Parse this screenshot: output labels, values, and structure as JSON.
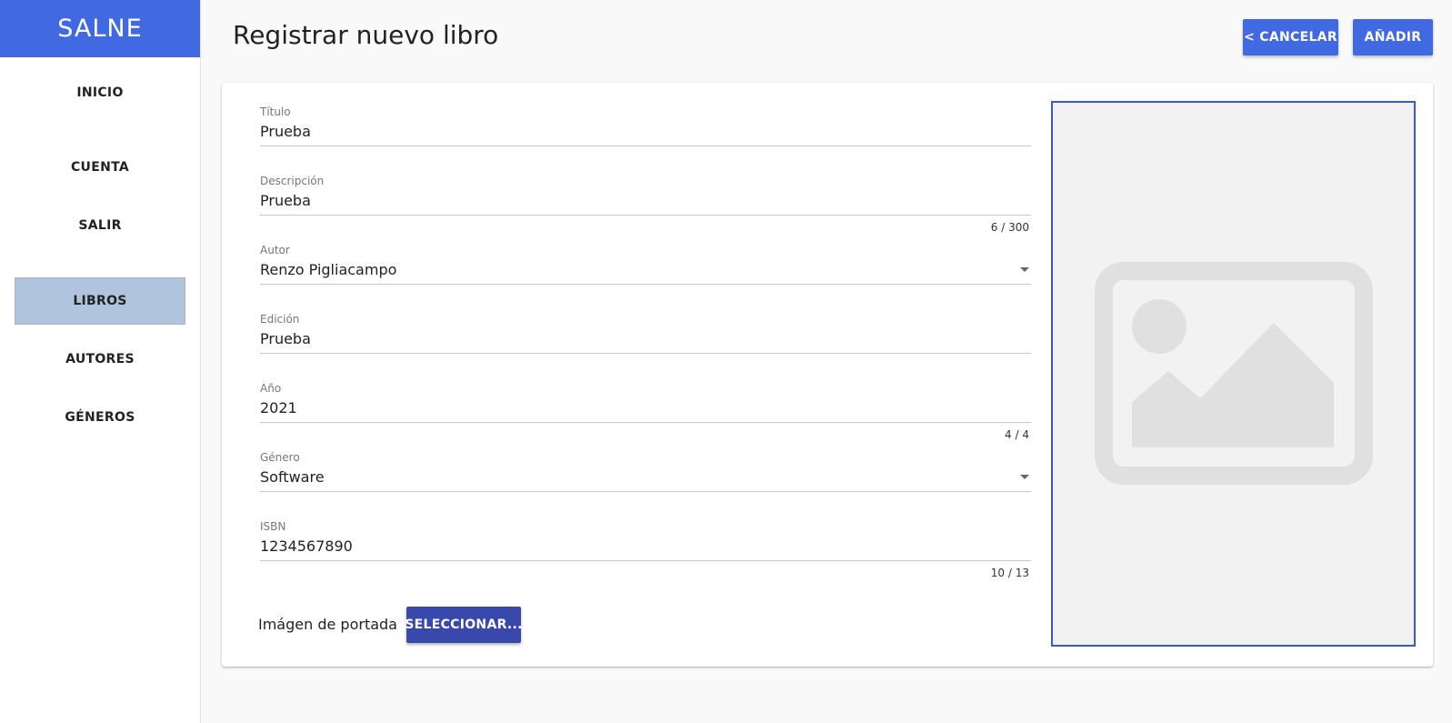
{
  "brand": "SALNE",
  "sidebar": {
    "items": [
      {
        "label": "INICIO"
      },
      {
        "label": "CUENTA"
      },
      {
        "label": "SALIR"
      },
      {
        "label": "LIBROS"
      },
      {
        "label": "AUTORES"
      },
      {
        "label": "GÉNEROS"
      }
    ],
    "active": "LIBROS"
  },
  "header": {
    "title": "Registrar nuevo libro",
    "cancel_label": "< CANCELAR",
    "add_label": "AÑADIR"
  },
  "form": {
    "titulo": {
      "label": "Título",
      "value": "Prueba"
    },
    "descripcion": {
      "label": "Descripción",
      "value": "Prueba",
      "counter": "6 / 300"
    },
    "autor": {
      "label": "Autor",
      "value": "Renzo Pigliacampo"
    },
    "edicion": {
      "label": "Edición",
      "value": "Prueba"
    },
    "anio": {
      "label": "Año",
      "value": "2021",
      "counter": "4 / 4"
    },
    "genero": {
      "label": "Género",
      "value": "Software"
    },
    "isbn": {
      "label": "ISBN",
      "value": "1234567890",
      "counter": "10 / 13"
    },
    "cover_label": "Imágen de portada",
    "select_label": "SELECCIONAR..."
  },
  "preview": {
    "icon": "image-placeholder-icon"
  },
  "colors": {
    "brand": "#4169e1",
    "active_nav": "#b0c4de",
    "select_button": "#3949ab",
    "preview_border": "#3a5bc7"
  }
}
